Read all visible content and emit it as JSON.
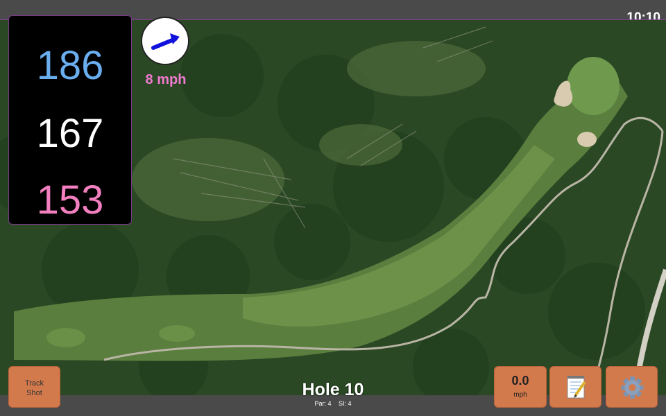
{
  "status": {
    "clock": "10:10"
  },
  "distances": {
    "back": "186",
    "middle": "167",
    "front": "153"
  },
  "wind": {
    "speed_label": "8 mph",
    "direction_icon": "arrow-up-right-icon"
  },
  "hole": {
    "title": "Hole 10",
    "par": "Par: 4",
    "si": "SI: 4"
  },
  "buttons": {
    "track_shot_line1": "Track",
    "track_shot_line2": "Shot",
    "wind_value": "0.0",
    "wind_unit": "mph",
    "notes_icon": "notepad-icon",
    "settings_icon": "gear-icon"
  },
  "colors": {
    "back_distance": "#6aaef0",
    "middle_distance": "#ffffff",
    "front_distance": "#f27fbf",
    "wind_text": "#f07ad0",
    "button": "#d37a4d",
    "border_accent": "#7c3a8c"
  }
}
